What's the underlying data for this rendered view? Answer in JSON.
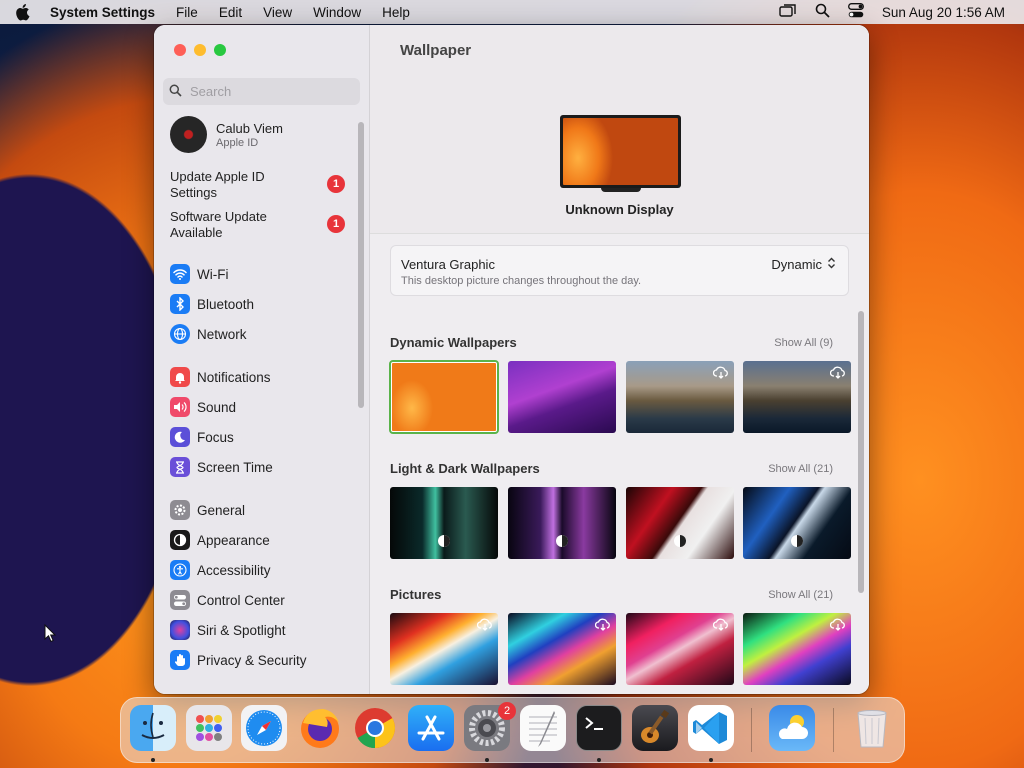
{
  "menubar": {
    "app_name": "System Settings",
    "menus": [
      "File",
      "Edit",
      "View",
      "Window",
      "Help"
    ],
    "clock": "Sun Aug 20  1:56 AM"
  },
  "sidebar": {
    "search_placeholder": "Search",
    "account": {
      "name": "Calub Viem",
      "subtitle": "Apple ID"
    },
    "notices": [
      {
        "label": "Update Apple ID Settings",
        "badge": "1"
      },
      {
        "label": "Software Update Available",
        "badge": "1"
      }
    ],
    "items": [
      {
        "label": "Wi-Fi",
        "icon": "wifi-icon",
        "color": "#1a7cf5"
      },
      {
        "label": "Bluetooth",
        "icon": "bluetooth-icon",
        "color": "#1a7cf5"
      },
      {
        "label": "Network",
        "icon": "network-icon",
        "color": "#1a7cf5"
      },
      {
        "label": "Notifications",
        "icon": "notifications-icon",
        "color": "#f04a4a"
      },
      {
        "label": "Sound",
        "icon": "sound-icon",
        "color": "#f04a6a"
      },
      {
        "label": "Focus",
        "icon": "focus-icon",
        "color": "#5b4fd8"
      },
      {
        "label": "Screen Time",
        "icon": "screen-time-icon",
        "color": "#6a4fd8"
      },
      {
        "label": "General",
        "icon": "gear-icon",
        "color": "#8e8c92"
      },
      {
        "label": "Appearance",
        "icon": "appearance-icon",
        "color": "#1a1a1a"
      },
      {
        "label": "Accessibility",
        "icon": "accessibility-icon",
        "color": "#1a7cf5"
      },
      {
        "label": "Control Center",
        "icon": "control-center-icon",
        "color": "#8e8c92"
      },
      {
        "label": "Siri & Spotlight",
        "icon": "siri-icon",
        "color": "#3a2a6a"
      },
      {
        "label": "Privacy & Security",
        "icon": "hand-icon",
        "color": "#1a7cf5"
      }
    ]
  },
  "main": {
    "title": "Wallpaper",
    "display_name": "Unknown Display",
    "current": {
      "name": "Ventura Graphic",
      "description": "This desktop picture changes throughout the day.",
      "mode": "Dynamic"
    },
    "sections": [
      {
        "title": "Dynamic Wallpapers",
        "show_all": "Show All (9)"
      },
      {
        "title": "Light & Dark Wallpapers",
        "show_all": "Show All (21)"
      },
      {
        "title": "Pictures",
        "show_all": "Show All (21)"
      }
    ]
  },
  "dock": {
    "apps": [
      "Finder",
      "Launchpad",
      "Safari",
      "Firefox",
      "Chrome",
      "App Store",
      "System Settings",
      "TextEdit",
      "Terminal",
      "GarageBand",
      "Visual Studio Code",
      "Weather",
      "Trash"
    ],
    "settings_badge": "2"
  }
}
